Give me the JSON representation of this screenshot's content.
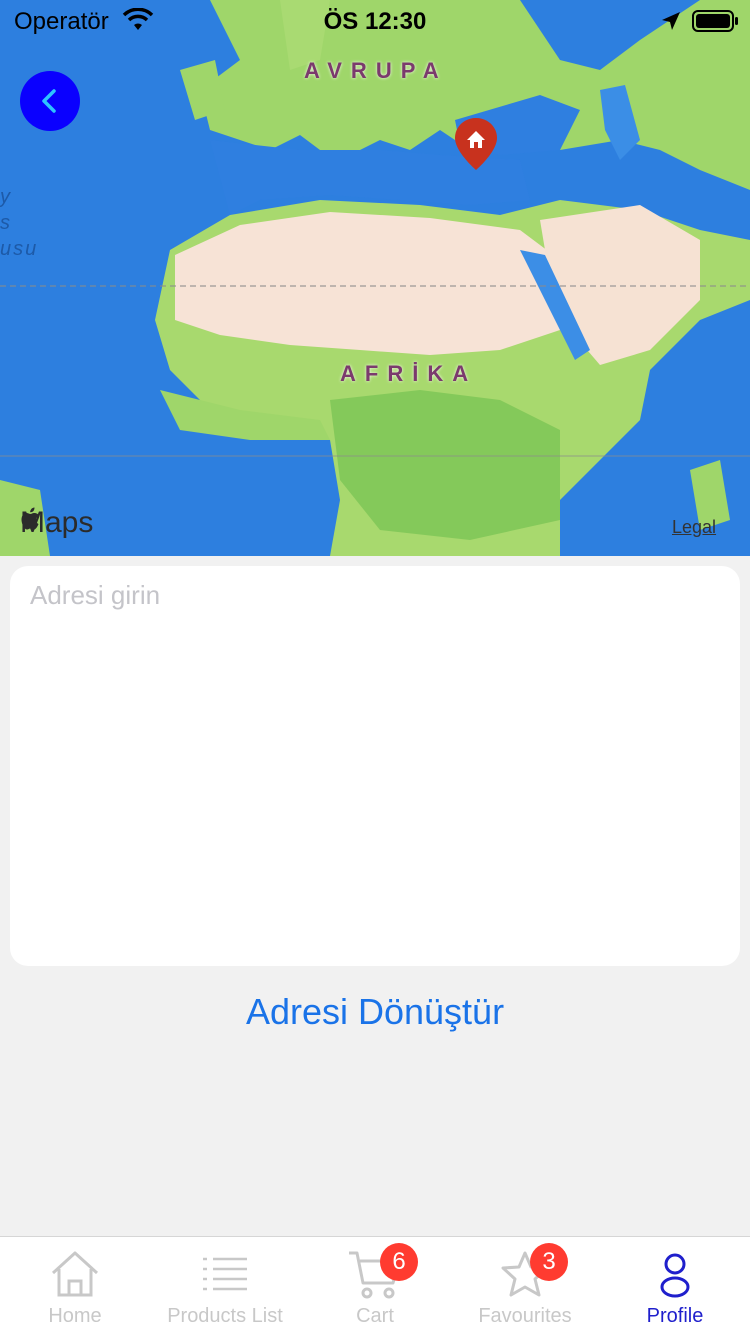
{
  "status_bar": {
    "carrier": "Operatör",
    "time": "ÖS 12:30"
  },
  "map": {
    "labels": {
      "europe": "AVRUPA",
      "africa": "AFRİKA",
      "ocean_partial": "y\ns\nusu"
    },
    "attribution": "Maps",
    "legal": "Legal",
    "pin_icon": "home-pin-icon"
  },
  "address": {
    "placeholder": "Adresi girin",
    "value": ""
  },
  "convert_button": "Adresi Dönüştür",
  "tabs": [
    {
      "label": "Home",
      "icon": "home-icon",
      "badge": ""
    },
    {
      "label": "Products List",
      "icon": "list-icon",
      "badge": ""
    },
    {
      "label": "Cart",
      "icon": "cart-icon",
      "badge": "6"
    },
    {
      "label": "Favourites",
      "icon": "star-icon",
      "badge": "3"
    },
    {
      "label": "Profile",
      "icon": "person-icon",
      "badge": ""
    }
  ],
  "colors": {
    "accent": "#1a73e8",
    "active_tab": "#1f1fcc",
    "back_button": "#0a00ff",
    "badge": "#ff3b30",
    "pin": "#c8321e"
  }
}
